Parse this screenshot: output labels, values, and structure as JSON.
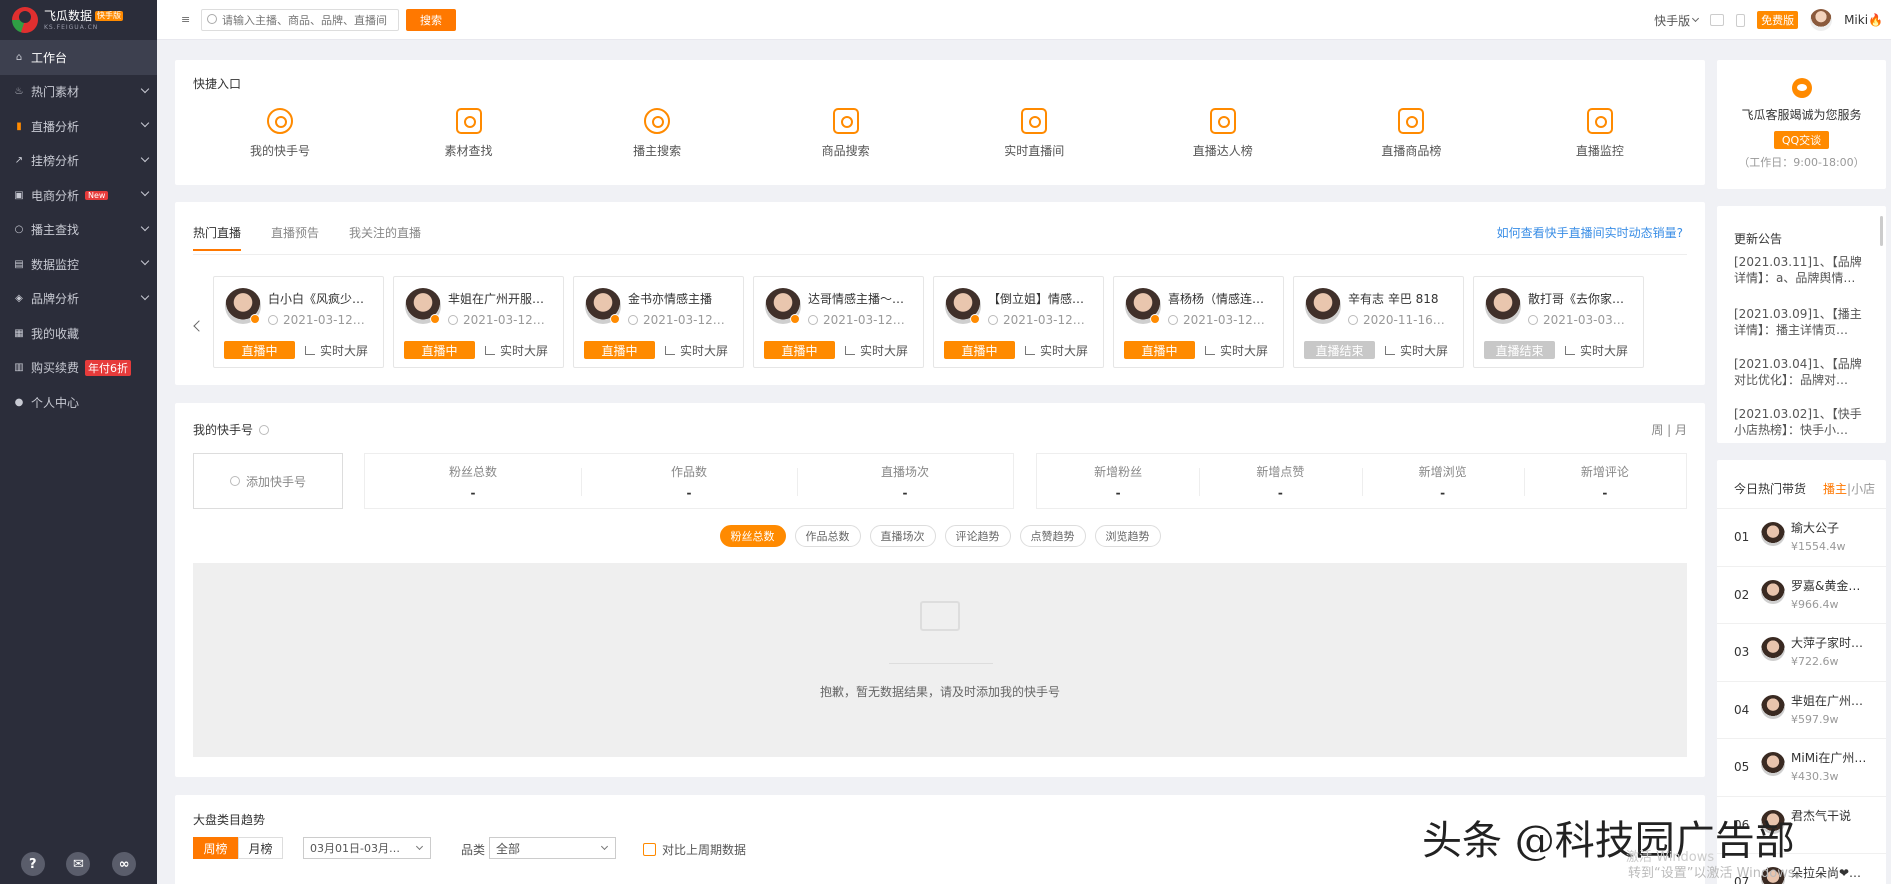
{
  "app": {
    "name": "飞瓜数据",
    "badge": "快手版",
    "subtitle": "KS.FEIGUA.CN"
  },
  "sidebar": {
    "items": [
      {
        "label": "工作台",
        "icon": "home-icon"
      },
      {
        "label": "热门素材",
        "icon": "fire-icon"
      },
      {
        "label": "直播分析",
        "icon": "bar-chart-icon"
      },
      {
        "label": "挂榜分析",
        "icon": "trend-icon"
      },
      {
        "label": "电商分析",
        "icon": "shop-icon",
        "tag": "New"
      },
      {
        "label": "播主查找",
        "icon": "search-icon"
      },
      {
        "label": "数据监控",
        "icon": "monitor-icon"
      },
      {
        "label": "品牌分析",
        "icon": "brand-icon"
      },
      {
        "label": "我的收藏",
        "icon": "star-icon"
      },
      {
        "label": "购买续费",
        "icon": "cart-icon",
        "tag": "年付6折"
      },
      {
        "label": "个人中心",
        "icon": "user-icon"
      }
    ],
    "bottom": {
      "help": "?",
      "wechat": "✉",
      "link": "∞"
    }
  },
  "topbar": {
    "menu_glyph": "≡",
    "search_placeholder": "请输入主播、商品、品牌、直播间",
    "search_button": "搜索",
    "version": "快手版",
    "free_badge": "免费版",
    "user": "Miki🔥"
  },
  "quick": {
    "title": "快捷入口",
    "items": [
      "我的快手号",
      "素材查找",
      "播主搜索",
      "商品搜索",
      "实时直播间",
      "直播达人榜",
      "直播商品榜",
      "直播监控"
    ]
  },
  "live": {
    "tabs": [
      "热门直播",
      "直播预告",
      "我关注的直播"
    ],
    "help_link": "如何查看快手直播间实时动态销量?",
    "screen_label": "实时大屏",
    "cards": [
      {
        "name": "白小白《风疯少…",
        "date": "2021-03-12…",
        "status": "直播中",
        "ended": false
      },
      {
        "name": "芈姐在广州开服…",
        "date": "2021-03-12…",
        "status": "直播中",
        "ended": false
      },
      {
        "name": "金书亦情感主播",
        "date": "2021-03-12…",
        "status": "直播中",
        "ended": false
      },
      {
        "name": "达哥情感主播～…",
        "date": "2021-03-12…",
        "status": "直播中",
        "ended": false
      },
      {
        "name": "【倒立姐】情感…",
        "date": "2021-03-12…",
        "status": "直播中",
        "ended": false
      },
      {
        "name": "喜杨杨（情感连…",
        "date": "2021-03-12…",
        "status": "直播中",
        "ended": false
      },
      {
        "name": "辛有志 辛巴 818",
        "date": "2020-11-16…",
        "status": "直播结束",
        "ended": true
      },
      {
        "name": "散打哥《去你家…",
        "date": "2021-03-03…",
        "status": "直播结束",
        "ended": true
      }
    ]
  },
  "mine": {
    "title": "我的快手号",
    "period": "周 | 月",
    "add_label": "添加快手号",
    "stats1": [
      {
        "label": "粉丝总数",
        "value": "-"
      },
      {
        "label": "作品数",
        "value": "-"
      },
      {
        "label": "直播场次",
        "value": "-"
      }
    ],
    "stats2": [
      {
        "label": "新增粉丝",
        "value": "-"
      },
      {
        "label": "新增点赞",
        "value": "-"
      },
      {
        "label": "新增浏览",
        "value": "-"
      },
      {
        "label": "新增评论",
        "value": "-"
      }
    ],
    "pills": [
      "粉丝总数",
      "作品总数",
      "直播场次",
      "评论趋势",
      "点赞趋势",
      "浏览趋势"
    ],
    "empty_text": "抱歉，暂无数据结果，请及时添加我的快手号"
  },
  "trend": {
    "title": "大盘类目趋势",
    "toggle": [
      "周榜",
      "月榜"
    ],
    "date_value": "03月01日-03月…",
    "category_label": "品类",
    "category_value": "全部",
    "compare_label": "对比上周期数据"
  },
  "service": {
    "title": "飞瓜客服竭诚为您服务",
    "qq_button": "QQ交谈",
    "hours": "（工作日：9:00-18:00）"
  },
  "notice": {
    "title": "更新公告",
    "items": [
      "[2021.03.11]1、【品牌详情】：a、品牌舆情…",
      "[2021.03.09]1、【播主详情】：播主详情页…",
      "[2021.03.04]1、【品牌对比优化】：品牌对…",
      "[2021.03.02]1、【快手小店热榜】：快手小…"
    ]
  },
  "hot": {
    "title": "今日热门带货",
    "tab_active": "播主",
    "tab_sep": "|",
    "tab_other": "小店",
    "items": [
      {
        "rank": "01",
        "name": "瑜大公子",
        "amount": "¥1554.4w"
      },
      {
        "rank": "02",
        "name": "罗嘉&黄金…",
        "amount": "¥966.4w"
      },
      {
        "rank": "03",
        "name": "大萍子家时…",
        "amount": "¥722.6w"
      },
      {
        "rank": "04",
        "name": "芈姐在广州…",
        "amount": "¥597.9w"
      },
      {
        "rank": "05",
        "name": "MiMi在广州…",
        "amount": "¥430.3w"
      },
      {
        "rank": "06",
        "name": "君杰气干说",
        "amount": ""
      },
      {
        "rank": "07",
        "name": "朵拉朵尚❤…",
        "amount": ""
      }
    ]
  },
  "watermark": {
    "main": "头条 @科技园广告部",
    "activate": "激活 Windows",
    "activate_sub": "转到“设置”以激活 Windows。"
  }
}
